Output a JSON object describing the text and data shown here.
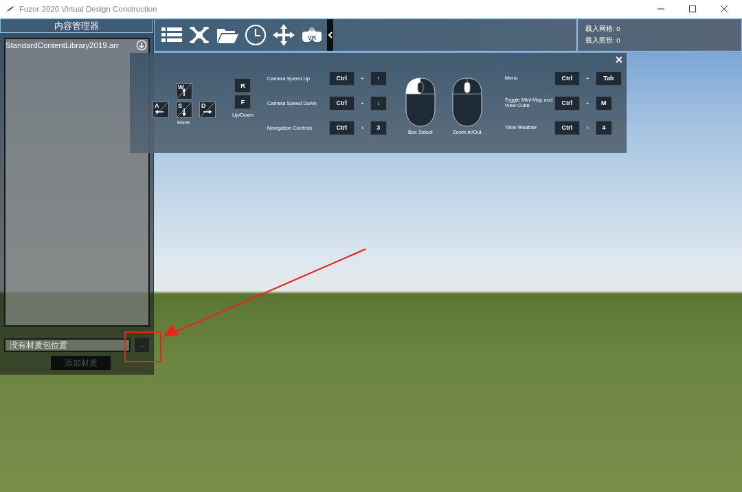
{
  "window": {
    "title": "Fuzor 2020 Virtual Design Construction"
  },
  "content_manager": {
    "title": "内容管理器",
    "libraries": [
      {
        "name": "StandardContentLibrary2019.arr",
        "selected": false
      }
    ],
    "material_path": {
      "placeholder": "没有材质包位置"
    },
    "browse_button": "...",
    "add_material_button": {
      "label": "添加材质",
      "disabled": true
    }
  },
  "toolbar": {
    "vr_icon_text": "VR",
    "stats": [
      "载入网格: 0",
      "载入图形: 0"
    ]
  },
  "help_overlay": {
    "movement_keys": [
      {
        "key": "W",
        "kind": "up"
      },
      {
        "key": "A",
        "kind": "left"
      },
      {
        "key": "S",
        "kind": "down"
      },
      {
        "key": "D",
        "kind": "right"
      }
    ],
    "move_label": "Move",
    "updown_keys": [
      "R",
      "F"
    ],
    "updown_label": "Up/Down",
    "shortcuts_left": [
      {
        "label": "Camera Speed Up",
        "modifier": "Ctrl",
        "plus": "+",
        "key": "↑"
      },
      {
        "label": "Camera Speed Down",
        "modifier": "Ctrl",
        "plus": "+",
        "key": "↓"
      },
      {
        "label": "Navigation Controls",
        "modifier": "Ctrl",
        "plus": "+",
        "key": "3"
      }
    ],
    "mice": [
      {
        "label": "Box Select",
        "kind": "left"
      },
      {
        "label": "Zoom In/Out",
        "kind": "wheel"
      }
    ],
    "shortcuts_right": [
      {
        "label": "Menu",
        "modifier": "Ctrl",
        "plus": "+",
        "key": "Tab"
      },
      {
        "label": "Toggle Mini Map and View Cube",
        "modifier": "Ctrl",
        "plus": "+",
        "key": "M"
      },
      {
        "label": "Time Weather",
        "modifier": "Ctrl",
        "plus": "+",
        "key": "4"
      }
    ]
  }
}
